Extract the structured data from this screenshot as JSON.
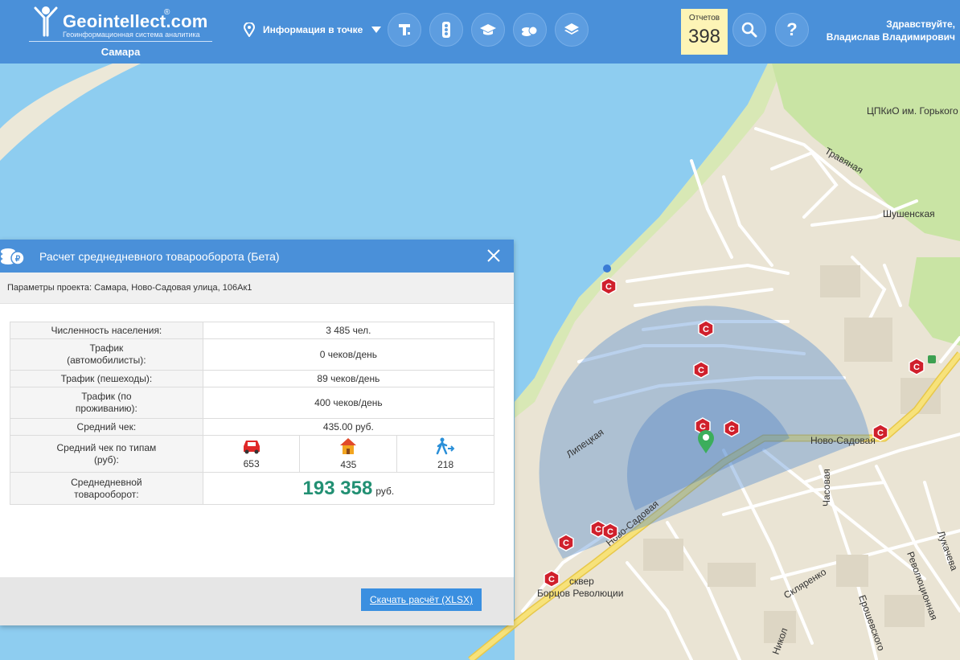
{
  "header": {
    "brand": "Geointellect",
    "brand_suffix": ".com",
    "registered": "®",
    "tagline": "Геоинформационная система аналитика",
    "city": "Самара",
    "info_point_label": "Информация в точке",
    "reports_label": "Отчетов",
    "reports_count": "398",
    "greeting_line1": "Здравствуйте,",
    "greeting_line2": "Владислав Владимирович"
  },
  "map": {
    "labels": {
      "park": "ЦПКиО им. Горького",
      "travyanaya": "Травяная",
      "shushenskaya": "Шушенская",
      "lipetskaya": "Липецкая",
      "novo_sadovaya": "Ново-Садовая",
      "novo_sadovaya_2": "Ново-Садовая",
      "chasovaya": "Часовая",
      "sklyarenko": "Скляренко",
      "eroshevskogo": "Ерошевского",
      "revolyutsionnaya": "Революционная",
      "lukacheva": "Лукачева",
      "square": "сквер",
      "bortsov": "Борцов Революции",
      "nikol": "Никол"
    },
    "colors": {
      "water": "#8ecdf0",
      "land": "#eae4d4",
      "park": "#c9e4a4",
      "radius": "#6fa0d8",
      "marker": "#d0202c"
    }
  },
  "modal": {
    "title": "Расчет среднедневного товарооборота (Бета)",
    "params": "Параметры проекта: Самара, Ново-Садовая улица, 106Ак1",
    "rows": [
      {
        "label": "Численность населения:",
        "value": "3 485 чел."
      },
      {
        "label": "Трафик (автомобилисты):",
        "value": "0 чеков/день"
      },
      {
        "label": "Трафик (пешеходы):",
        "value": "89 чеков/день"
      },
      {
        "label": "Трафик (по проживанию):",
        "value": "400 чеков/день"
      },
      {
        "label": "Средний чек:",
        "value": "435.00 руб."
      }
    ],
    "avg_by_type": {
      "label": "Средний чек по типам (руб):",
      "types": [
        {
          "icon": "car-icon",
          "value": "653"
        },
        {
          "icon": "house-icon",
          "value": "435"
        },
        {
          "icon": "pedestrian-icon",
          "value": "218"
        }
      ]
    },
    "turnover": {
      "label": "Среднедневной товарооборот:",
      "value": "193 358",
      "unit": "руб."
    },
    "download_label": "Скачать расчёт (XLSX)"
  }
}
